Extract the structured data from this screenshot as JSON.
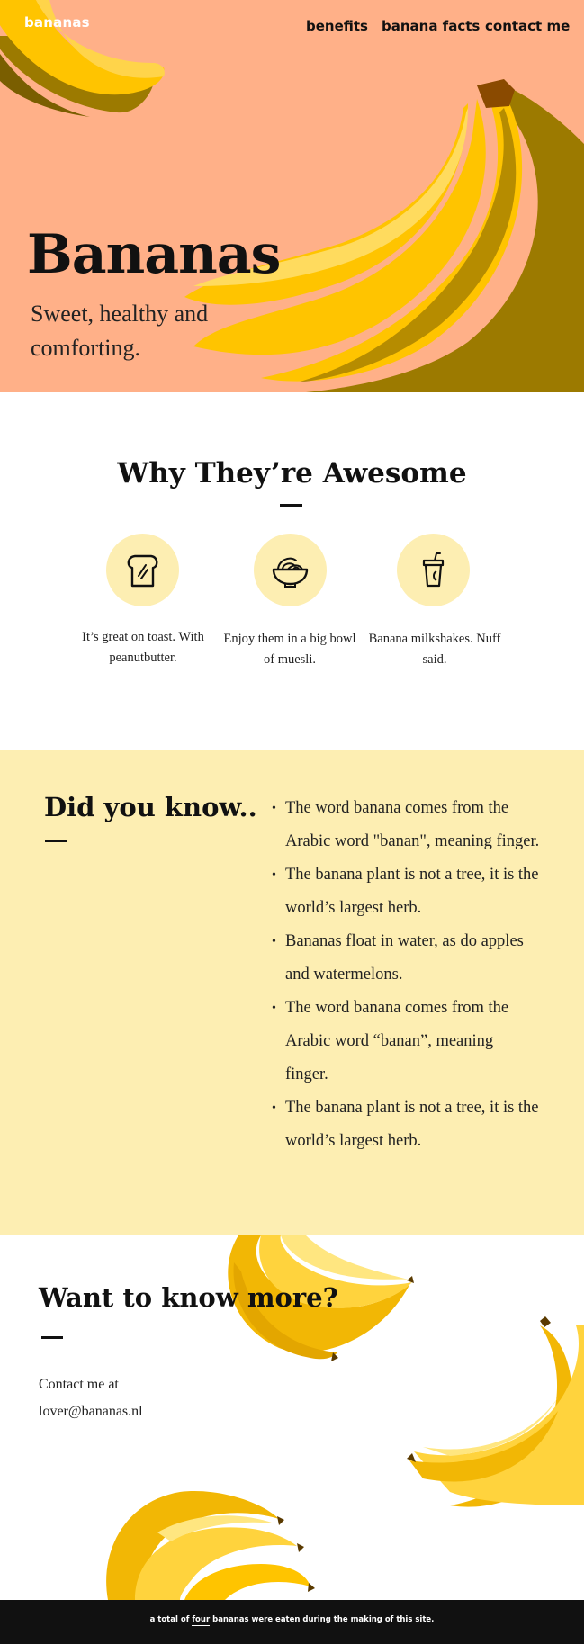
{
  "header": {
    "logo": "bananas",
    "nav": [
      "benefits",
      "banana facts",
      "contact me"
    ]
  },
  "hero": {
    "title": "Bananas",
    "subtitle": "Sweet, healthy and comforting."
  },
  "why": {
    "title": "Why They’re Awesome",
    "features": [
      {
        "icon": "toast-icon",
        "text": "It’s great on toast. With peanutbutter."
      },
      {
        "icon": "muesli-bowl-icon",
        "text": "Enjoy them in a big bowl of muesli."
      },
      {
        "icon": "milkshake-cup-icon",
        "text": "Banana milkshakes. Nuff said."
      }
    ]
  },
  "facts": {
    "title": "Did you know..",
    "items": [
      "The word banana comes from the Arabic word \"banan\", meaning finger.",
      "The banana plant is not a tree, it is the world’s largest herb.",
      "Bananas float in water, as do apples and watermelons.",
      "The word banana comes from the Arabic word “banan”, meaning finger.",
      "The banana plant is not a tree, it is the world’s largest herb."
    ]
  },
  "more": {
    "title": "Want to know more?",
    "contact_line1": "Contact me at",
    "contact_line2": "lover@bananas.nl"
  },
  "footer": {
    "before": "a total of",
    "highlight": "four",
    "after": "bananas were eaten during the making of this site."
  },
  "colors": {
    "hero_bg": "#FFB088",
    "banana_yellow": "#FFC400",
    "banana_shadow": "#9C7A00",
    "pale_yellow": "#FDEEB2",
    "footer_bg": "#111111"
  }
}
